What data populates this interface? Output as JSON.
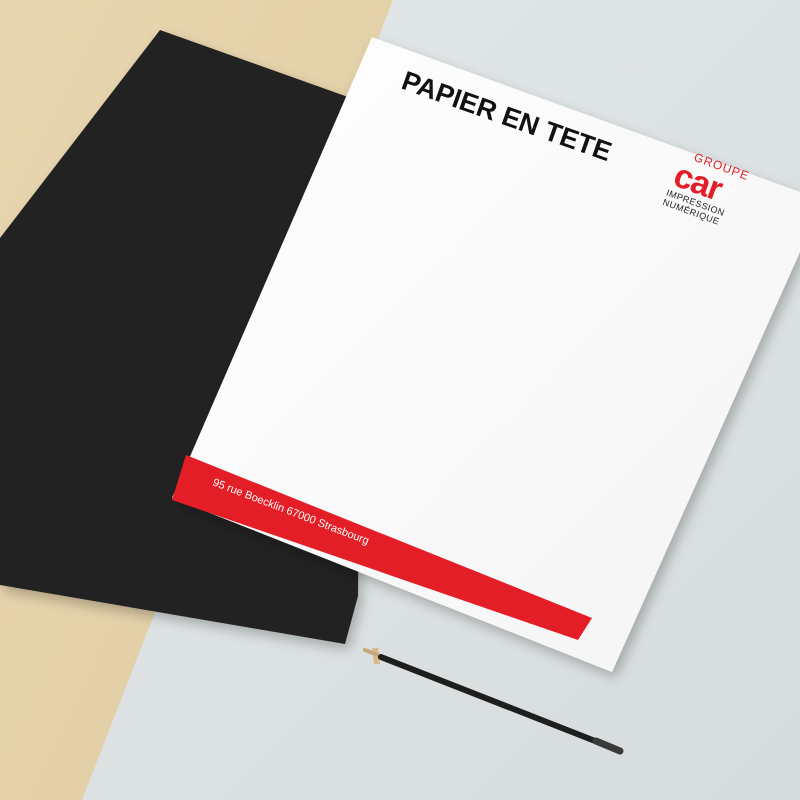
{
  "letterhead": {
    "title": "PAPIER EN TETE",
    "address": "95 rue Boecklin 67000 Strasbourg"
  },
  "logo": {
    "groupe": "GROUPE",
    "brand": "car",
    "impression": "IMPRESSION",
    "numerique": "NUMÉRIQUE"
  },
  "colors": {
    "background_light": "#dde2e3",
    "background_beige": "#e6d3ab",
    "black_sheet": "#232323",
    "paper": "#ffffff",
    "brand_red": "#e41e26",
    "pencil": "#1e1e1e"
  }
}
